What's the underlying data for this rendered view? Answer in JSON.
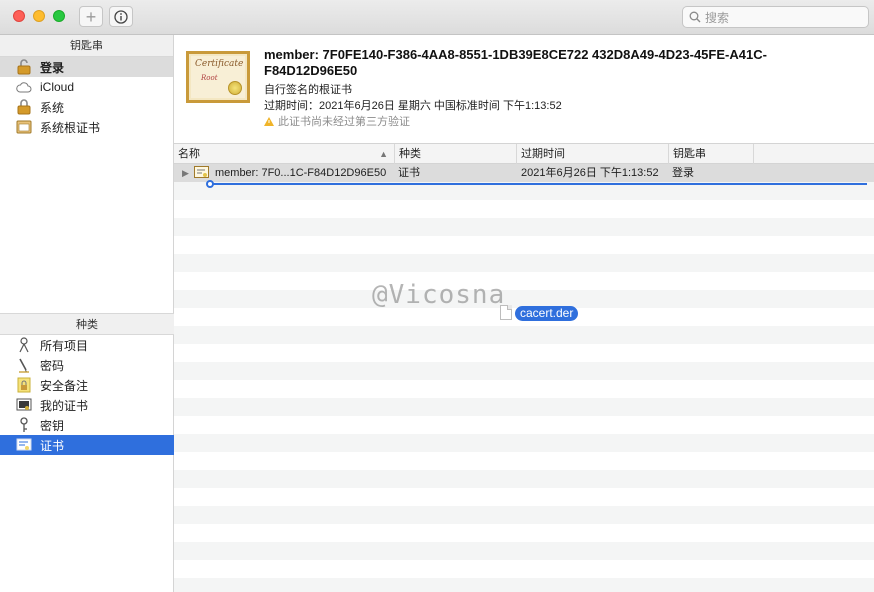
{
  "search": {
    "placeholder": "搜索"
  },
  "sidebar": {
    "keychains_header": "钥匙串",
    "keychains": [
      {
        "label": "登录",
        "icon": "unlocked-padlock-icon"
      },
      {
        "label": "iCloud",
        "icon": "cloud-icon"
      },
      {
        "label": "系统",
        "icon": "locked-padlock-icon"
      },
      {
        "label": "系统根证书",
        "icon": "cabinet-icon"
      }
    ],
    "category_header": "种类",
    "categories": [
      {
        "label": "所有项目",
        "icon": "keys-icon"
      },
      {
        "label": "密码",
        "icon": "pencil-icon"
      },
      {
        "label": "安全备注",
        "icon": "secure-note-icon"
      },
      {
        "label": "我的证书",
        "icon": "my-certificate-icon"
      },
      {
        "label": "密钥",
        "icon": "key-icon"
      },
      {
        "label": "证书",
        "icon": "certificate-icon"
      }
    ]
  },
  "detail": {
    "title": "member: 7F0FE140-F386-4AA8-8551-1DB39E8CE722 432D8A49-4D23-45FE-A41C-F84D12D96E50",
    "subtitle": "自行签名的根证书",
    "expiry": "过期时间：2021年6月26日 星期六 中国标准时间 下午1:13:52",
    "warning": "此证书尚未经过第三方验证",
    "badge_title": "Certificate",
    "badge_sub": "Root"
  },
  "table": {
    "columns": [
      "名称",
      "种类",
      "过期时间",
      "钥匙串"
    ],
    "rows": [
      {
        "name": "member: 7F0...1C-F84D12D96E50",
        "kind": "证书",
        "expires": "2021年6月26日 下午1:13:52",
        "keychain": "登录"
      }
    ]
  },
  "overlay": {
    "watermark": "@Vicosna",
    "drag_file": "cacert.der"
  },
  "colors": {
    "selection_blue": "#2f6fdd",
    "accent_gold": "#c99a3a"
  }
}
